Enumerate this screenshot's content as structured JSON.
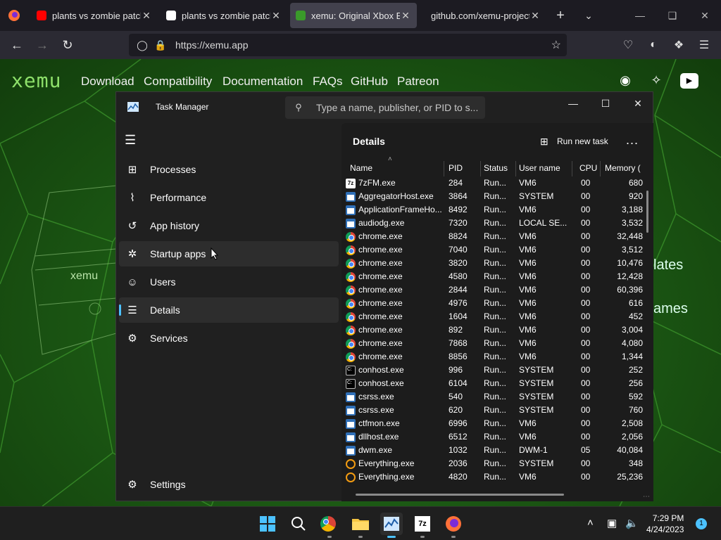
{
  "browser": {
    "tabs": [
      {
        "title": "plants vs zombie patch",
        "favicon": "youtube-icon"
      },
      {
        "title": "plants vs zombie patch",
        "favicon": "google-icon"
      },
      {
        "title": "xemu: Original Xbox Em",
        "favicon": "xemu-icon",
        "active": true
      },
      {
        "title": "github.com/xemu-project/",
        "favicon": "none"
      }
    ],
    "url": "https://xemu.app"
  },
  "site": {
    "logo": "xemu",
    "nav": [
      "Download",
      "Compatibility",
      "Documentation",
      "FAQs",
      "GitHub",
      "Patreon"
    ],
    "bg_words": [
      "lates",
      "ames"
    ],
    "console_label": "xemu"
  },
  "task_manager": {
    "title": "Task Manager",
    "search_placeholder": "Type a name, publisher, or PID to s...",
    "sidebar": [
      {
        "label": "Processes",
        "icon": "processes-icon"
      },
      {
        "label": "Performance",
        "icon": "performance-icon"
      },
      {
        "label": "App history",
        "icon": "app-history-icon"
      },
      {
        "label": "Startup apps",
        "icon": "startup-apps-icon"
      },
      {
        "label": "Users",
        "icon": "users-icon"
      },
      {
        "label": "Details",
        "icon": "details-icon",
        "selected": true
      },
      {
        "label": "Services",
        "icon": "services-icon"
      }
    ],
    "settings_label": "Settings",
    "details_title": "Details",
    "run_new_task": "Run new task",
    "more": "...",
    "columns": [
      "Name",
      "PID",
      "Status",
      "User name",
      "CPU",
      "Memory ("
    ],
    "rows": [
      {
        "name": "7zFM.exe",
        "pid": "284",
        "status": "Run...",
        "user": "VM6",
        "cpu": "00",
        "mem": "680",
        "icon": "7z"
      },
      {
        "name": "AggregatorHost.exe",
        "pid": "3864",
        "status": "Run...",
        "user": "SYSTEM",
        "cpu": "00",
        "mem": "920",
        "icon": "app"
      },
      {
        "name": "ApplicationFrameHo...",
        "pid": "8492",
        "status": "Run...",
        "user": "VM6",
        "cpu": "00",
        "mem": "3,188",
        "icon": "app"
      },
      {
        "name": "audiodg.exe",
        "pid": "7320",
        "status": "Run...",
        "user": "LOCAL SE...",
        "cpu": "00",
        "mem": "3,532",
        "icon": "app"
      },
      {
        "name": "chrome.exe",
        "pid": "8824",
        "status": "Run...",
        "user": "VM6",
        "cpu": "00",
        "mem": "32,448",
        "icon": "chrome"
      },
      {
        "name": "chrome.exe",
        "pid": "7040",
        "status": "Run...",
        "user": "VM6",
        "cpu": "00",
        "mem": "3,512",
        "icon": "chrome"
      },
      {
        "name": "chrome.exe",
        "pid": "3820",
        "status": "Run...",
        "user": "VM6",
        "cpu": "00",
        "mem": "10,476",
        "icon": "chrome"
      },
      {
        "name": "chrome.exe",
        "pid": "4580",
        "status": "Run...",
        "user": "VM6",
        "cpu": "00",
        "mem": "12,428",
        "icon": "chrome"
      },
      {
        "name": "chrome.exe",
        "pid": "2844",
        "status": "Run...",
        "user": "VM6",
        "cpu": "00",
        "mem": "60,396",
        "icon": "chrome"
      },
      {
        "name": "chrome.exe",
        "pid": "4976",
        "status": "Run...",
        "user": "VM6",
        "cpu": "00",
        "mem": "616",
        "icon": "chrome"
      },
      {
        "name": "chrome.exe",
        "pid": "1604",
        "status": "Run...",
        "user": "VM6",
        "cpu": "00",
        "mem": "452",
        "icon": "chrome"
      },
      {
        "name": "chrome.exe",
        "pid": "892",
        "status": "Run...",
        "user": "VM6",
        "cpu": "00",
        "mem": "3,004",
        "icon": "chrome"
      },
      {
        "name": "chrome.exe",
        "pid": "7868",
        "status": "Run...",
        "user": "VM6",
        "cpu": "00",
        "mem": "4,080",
        "icon": "chrome"
      },
      {
        "name": "chrome.exe",
        "pid": "8856",
        "status": "Run...",
        "user": "VM6",
        "cpu": "00",
        "mem": "1,344",
        "icon": "chrome"
      },
      {
        "name": "conhost.exe",
        "pid": "996",
        "status": "Run...",
        "user": "SYSTEM",
        "cpu": "00",
        "mem": "252",
        "icon": "con"
      },
      {
        "name": "conhost.exe",
        "pid": "6104",
        "status": "Run...",
        "user": "SYSTEM",
        "cpu": "00",
        "mem": "256",
        "icon": "con"
      },
      {
        "name": "csrss.exe",
        "pid": "540",
        "status": "Run...",
        "user": "SYSTEM",
        "cpu": "00",
        "mem": "592",
        "icon": "app"
      },
      {
        "name": "csrss.exe",
        "pid": "620",
        "status": "Run...",
        "user": "SYSTEM",
        "cpu": "00",
        "mem": "760",
        "icon": "app"
      },
      {
        "name": "ctfmon.exe",
        "pid": "6996",
        "status": "Run...",
        "user": "VM6",
        "cpu": "00",
        "mem": "2,508",
        "icon": "app"
      },
      {
        "name": "dllhost.exe",
        "pid": "6512",
        "status": "Run...",
        "user": "VM6",
        "cpu": "00",
        "mem": "2,056",
        "icon": "app"
      },
      {
        "name": "dwm.exe",
        "pid": "1032",
        "status": "Run...",
        "user": "DWM-1",
        "cpu": "05",
        "mem": "40,084",
        "icon": "app"
      },
      {
        "name": "Everything.exe",
        "pid": "2036",
        "status": "Run...",
        "user": "SYSTEM",
        "cpu": "00",
        "mem": "348",
        "icon": "ev"
      },
      {
        "name": "Everything.exe",
        "pid": "4820",
        "status": "Run...",
        "user": "VM6",
        "cpu": "00",
        "mem": "25,236",
        "icon": "ev"
      }
    ]
  },
  "taskbar": {
    "time": "7:29 PM",
    "date": "4/24/2023",
    "notifications": "1",
    "apps": [
      "start-icon",
      "search-icon",
      "chrome-icon",
      "file-explorer-icon",
      "task-manager-icon",
      "7zip-icon",
      "firefox-icon"
    ]
  },
  "colors": {
    "accent": "#4cc2ff",
    "xemu_green": "#8ee06a",
    "tm_bg": "#202020"
  }
}
